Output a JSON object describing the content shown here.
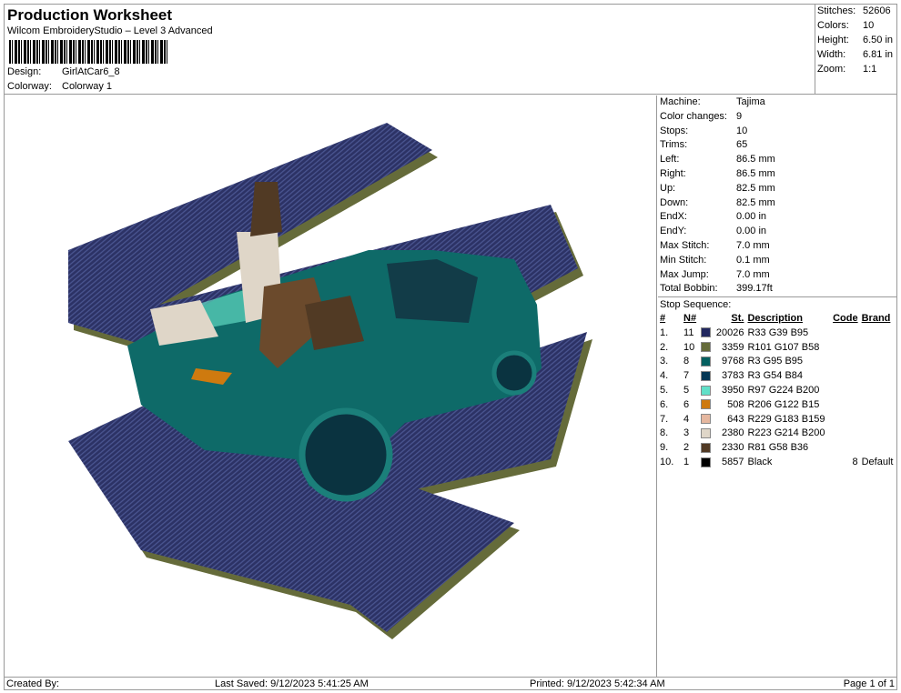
{
  "header": {
    "title": "Production Worksheet",
    "subtitle": "Wilcom EmbroideryStudio – Level 3 Advanced",
    "design_label": "Design:",
    "design": "GirlAtCar6_8",
    "colorway_label": "Colorway:",
    "colorway": "Colorway 1"
  },
  "stats": [
    {
      "k": "Stitches:",
      "v": "52606"
    },
    {
      "k": "Colors:",
      "v": "10"
    },
    {
      "k": "Height:",
      "v": "6.50 in"
    },
    {
      "k": "Width:",
      "v": "6.81 in"
    },
    {
      "k": "Zoom:",
      "v": "1:1"
    }
  ],
  "machine_info": [
    {
      "k": "Machine:",
      "v": "Tajima"
    },
    {
      "k": "Color changes:",
      "v": "9"
    },
    {
      "k": "Stops:",
      "v": "10"
    },
    {
      "k": "Trims:",
      "v": "65"
    },
    {
      "k": "Left:",
      "v": "86.5 mm"
    },
    {
      "k": "Right:",
      "v": "86.5 mm"
    },
    {
      "k": "Up:",
      "v": "82.5 mm"
    },
    {
      "k": "Down:",
      "v": "82.5 mm"
    },
    {
      "k": "EndX:",
      "v": "0.00 in"
    },
    {
      "k": "EndY:",
      "v": "0.00 in"
    },
    {
      "k": "Max Stitch:",
      "v": "7.0 mm"
    },
    {
      "k": "Min Stitch:",
      "v": "0.1 mm"
    },
    {
      "k": "Max Jump:",
      "v": "7.0 mm"
    },
    {
      "k": "Total Bobbin:",
      "v": "399.17ft"
    }
  ],
  "stop_sequence": {
    "title": "Stop Sequence:",
    "columns": [
      "#",
      "N#",
      "St.",
      "Description",
      "Code",
      "Brand"
    ],
    "rows": [
      {
        "n": "1.",
        "needle": "11",
        "color": "#21275f",
        "st": "20026",
        "desc": "R33 G39 B95",
        "code": "",
        "brand": ""
      },
      {
        "n": "2.",
        "needle": "10",
        "color": "#656b3a",
        "st": "3359",
        "desc": "R101 G107 B58",
        "code": "",
        "brand": ""
      },
      {
        "n": "3.",
        "needle": "8",
        "color": "#035f5f",
        "st": "9768",
        "desc": "R3 G95 B95",
        "code": "",
        "brand": ""
      },
      {
        "n": "4.",
        "needle": "7",
        "color": "#033654",
        "st": "3783",
        "desc": "R3 G54 B84",
        "code": "",
        "brand": ""
      },
      {
        "n": "5.",
        "needle": "5",
        "color": "#61e0c8",
        "st": "3950",
        "desc": "R97 G224 B200",
        "code": "",
        "brand": ""
      },
      {
        "n": "6.",
        "needle": "6",
        "color": "#ce7a0f",
        "st": "508",
        "desc": "R206 G122 B15",
        "code": "",
        "brand": ""
      },
      {
        "n": "7.",
        "needle": "4",
        "color": "#e5b79f",
        "st": "643",
        "desc": "R229 G183 B159",
        "code": "",
        "brand": ""
      },
      {
        "n": "8.",
        "needle": "3",
        "color": "#dfd6c8",
        "st": "2380",
        "desc": "R223 G214 B200",
        "code": "",
        "brand": ""
      },
      {
        "n": "9.",
        "needle": "2",
        "color": "#513a24",
        "st": "2330",
        "desc": "R81 G58 B36",
        "code": "",
        "brand": ""
      },
      {
        "n": "10.",
        "needle": "1",
        "color": "#000000",
        "st": "5857",
        "desc": "Black",
        "code": "8",
        "brand": "Default"
      }
    ]
  },
  "footer": {
    "created": "Created By:",
    "saved": "Last Saved: 9/12/2023 5:41:25 AM",
    "printed": "Printed: 9/12/2023 5:42:34 AM",
    "page": "Page 1 of 1"
  }
}
